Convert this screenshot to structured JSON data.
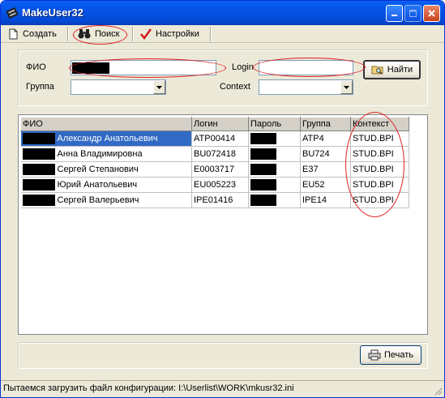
{
  "window": {
    "title": "MakeUser32"
  },
  "menu": {
    "items": [
      {
        "label": "Создать",
        "icon": "new-document-icon"
      },
      {
        "label": "Поиск",
        "icon": "binoculars-icon"
      },
      {
        "label": "Настройки",
        "icon": "checkmark-icon"
      }
    ]
  },
  "search": {
    "fio_label": "ФИО",
    "fio_value": "",
    "group_label": "Группа",
    "group_value": "",
    "login_label": "Login",
    "login_value": "",
    "context_label": "Context",
    "context_value": "",
    "find_button": "Найти"
  },
  "table": {
    "columns": [
      "ФИО",
      "Логин",
      "Пароль",
      "Группа",
      "Контекст"
    ],
    "rows": [
      {
        "fio": "Александр Анатольевич",
        "login": "ATP00414",
        "password": "",
        "group": "ATP4",
        "context": "STUD.BPI",
        "selected": true
      },
      {
        "fio": "Анна Владимировна",
        "login": "BU072418",
        "password": "",
        "group": "BU724",
        "context": "STUD.BPI",
        "selected": false
      },
      {
        "fio": "Сергей Степанович",
        "login": "E0003717",
        "password": "",
        "group": "E37",
        "context": "STUD.BPI",
        "selected": false
      },
      {
        "fio": "Юрий Анатольевич",
        "login": "EU005223",
        "password": "",
        "group": "EU52",
        "context": "STUD.BPI",
        "selected": false
      },
      {
        "fio": "Сергей Валерьевич",
        "login": "IPE01416",
        "password": "",
        "group": "IPE14",
        "context": "STUD.BPI",
        "selected": false
      }
    ]
  },
  "print_button": "Печать",
  "status": {
    "text": "Пытаемся загрузить файл конфигурации: I:\\Userlist\\WORK\\mkusr32.ini"
  },
  "colors": {
    "titlebar": "#0454e6",
    "selection": "#316ac5",
    "annotation": "#e02020",
    "window_bg": "#ece9d8"
  }
}
